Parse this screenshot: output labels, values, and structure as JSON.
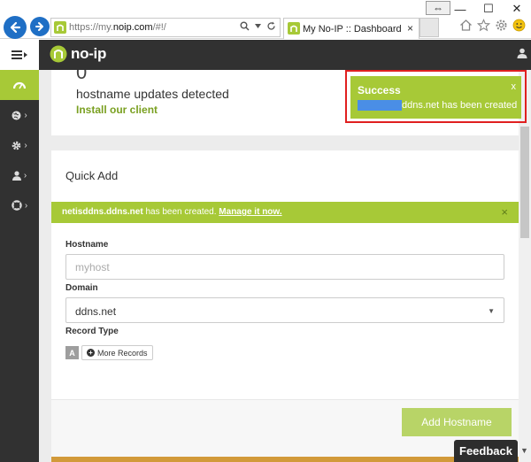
{
  "browser": {
    "url_prefix": "https://my.",
    "url_domain": "noip.com",
    "url_suffix": "/#!/",
    "tab_title": "My No-IP :: Dashboard",
    "tab_close": "×",
    "win_minimize": "—",
    "win_maximize": "☐",
    "win_close": "✕",
    "resize_glyph": "⇔"
  },
  "app": {
    "logo_text": "no-ip"
  },
  "sidebar": {
    "chevron": "›"
  },
  "dashboard": {
    "updates_count": "0",
    "updates_label": "hostname updates detected",
    "install_link": "Install our client"
  },
  "quick_add": {
    "title": "Quick Add",
    "banner_host": "netisddns.ddns.net",
    "banner_text": " has been created. ",
    "banner_link": "Manage it now.",
    "banner_close": "×",
    "hostname_label": "Hostname",
    "hostname_placeholder": "myhost",
    "domain_label": "Domain",
    "domain_value": "ddns.net",
    "domain_caret": "▼",
    "record_type_label": "Record Type",
    "record_type_value": "A",
    "more_records_plus": "+",
    "more_records_label": "More Records",
    "add_button": "Add Hostname"
  },
  "toast": {
    "title": "Success",
    "close": "x",
    "message": "ddns.net has been created"
  },
  "feedback_label": "Feedback",
  "colors": {
    "accent": "#a7c937",
    "dark": "#313131",
    "highlight_outline": "#e02020"
  }
}
